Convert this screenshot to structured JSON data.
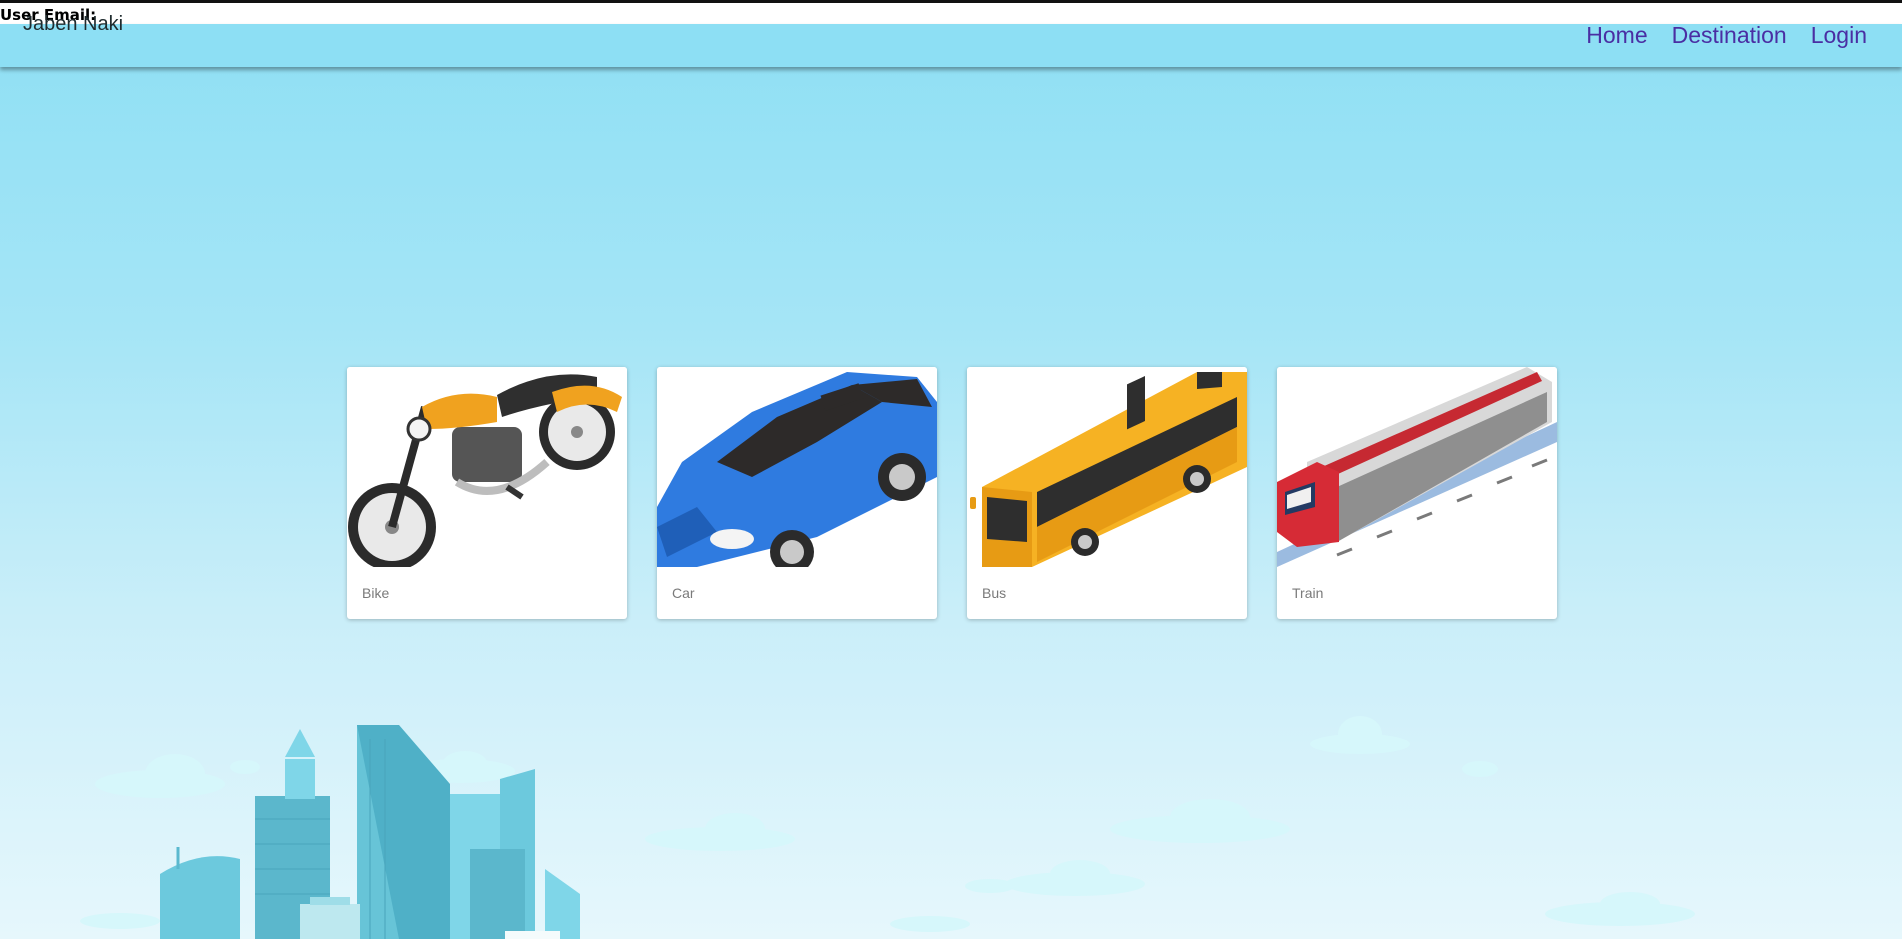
{
  "header": {
    "user_email_label": "User Email:",
    "brand": "Jaben Naki",
    "nav": [
      "Home",
      "Destination",
      "Login"
    ]
  },
  "vehicles": [
    {
      "label": "Bike",
      "icon": "motorcycle-icon"
    },
    {
      "label": "Car",
      "icon": "car-icon"
    },
    {
      "label": "Bus",
      "icon": "bus-icon"
    },
    {
      "label": "Train",
      "icon": "train-icon"
    }
  ],
  "colors": {
    "sky": "#8ddff4",
    "nav_link": "#4a2ea3",
    "bike_accent": "#f0a21f",
    "car_body": "#2f7be0",
    "bus_body": "#f6b223",
    "train_nose": "#d62b36"
  }
}
